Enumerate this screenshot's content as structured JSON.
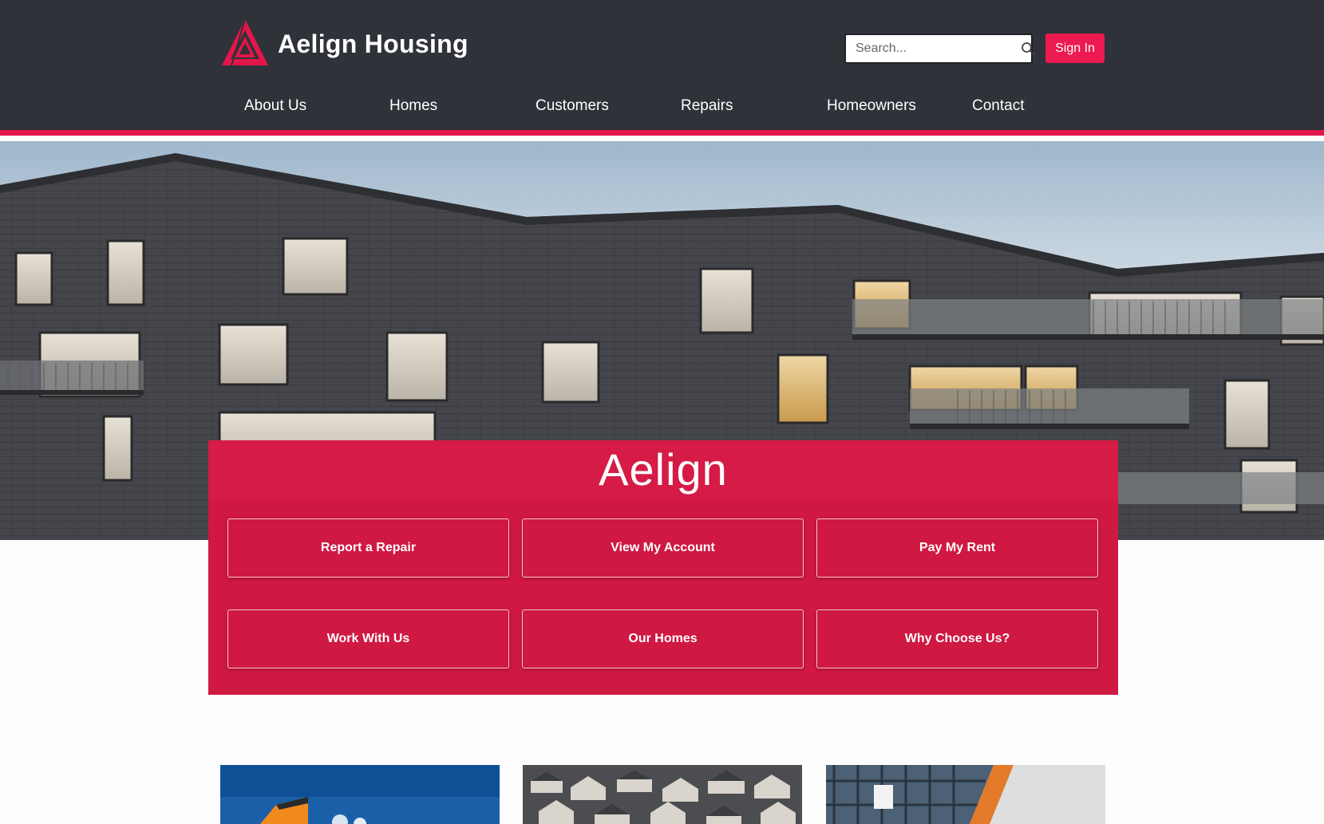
{
  "brand": {
    "name": "Aelign Housing",
    "color": "#e3164a"
  },
  "search": {
    "placeholder": "Search..."
  },
  "auth": {
    "signin_label": "Sign In"
  },
  "nav": {
    "items": [
      "About Us",
      "Homes",
      "Customers",
      "Repairs",
      "Homeowners",
      "Contact"
    ]
  },
  "hero": {
    "title": "Aelign"
  },
  "quick_links": [
    "Report a Repair",
    "View My Account",
    "Pay My Rent",
    "Work With Us",
    "Our Homes",
    "Why Choose Us?"
  ],
  "icons": {
    "logo": "triangle-logo-icon",
    "search": "search-icon"
  },
  "colors": {
    "header_bg": "#2f3238",
    "accent": "#e3164a",
    "panel_bg": "#cf1842",
    "signin_bg": "#ec1a50"
  }
}
